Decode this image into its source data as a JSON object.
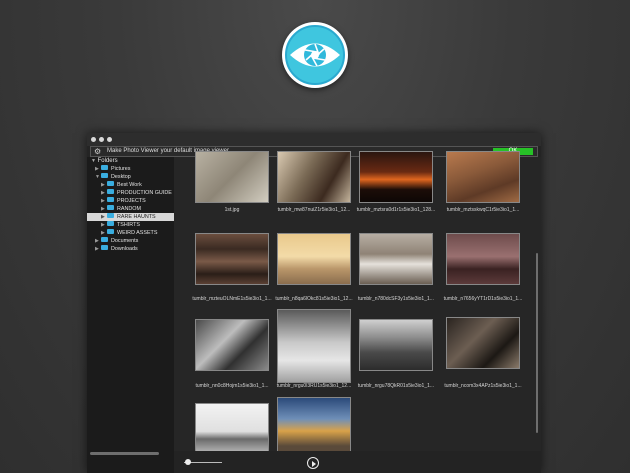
{
  "notification": {
    "message": "Make Photo Viewer your default image viewer.",
    "ok_label": "OK"
  },
  "sidebar": {
    "header": "Folders",
    "items": [
      {
        "label": "Pictures"
      },
      {
        "label": "Desktop"
      },
      {
        "label": "Best Work"
      },
      {
        "label": "PRODUCTION GUIDE"
      },
      {
        "label": "PROJECTS"
      },
      {
        "label": "RANDOM"
      },
      {
        "label": "RARE HAUNTS",
        "selected": true
      },
      {
        "label": "TSHIRTS"
      },
      {
        "label": "WEIRD ASSETS"
      },
      {
        "label": "Documents"
      },
      {
        "label": "Downloads"
      }
    ]
  },
  "thumbnails": [
    {
      "caption": "1st.jpg"
    },
    {
      "caption": "tumblr_mw87nuiZ1r5ie3io1_12..."
    },
    {
      "caption": "tumblr_mztsra0d1r1s5ie3io1_128..."
    },
    {
      "caption": "tumblr_mztsskwqC1r5ie3io1_1..."
    },
    {
      "caption": "tumblr_mzteuOLNmE1s5ie3io1_1..."
    },
    {
      "caption": "tumblr_n8qa6lOkc81s5ie3io1_12..."
    },
    {
      "caption": "tumblr_n780dcSF3y1s5ie3io1_1..."
    },
    {
      "caption": "tumblr_n7656yYT1rD1s5ie3io1_1..."
    },
    {
      "caption": "tumblr_nn0c8Hojm1s5ie3io1_1..."
    },
    {
      "caption": "tumblr_nrgu0l3RU1s5ie3io1_12..."
    },
    {
      "caption": "tumblr_nrgu78QkR01s5ie3io1_1..."
    },
    {
      "caption": "tumblr_ncom3x4APz1s5ie3io1_1..."
    },
    {
      "caption": ""
    },
    {
      "caption": ""
    }
  ],
  "zoom_slider": {
    "value": 0.1
  },
  "colors": {
    "accent": "#27c227",
    "folder": "#3aaee0",
    "logo_cyan": "#36c4de"
  },
  "icons": {
    "logo": "aperture-eye-icon",
    "play": "play-icon",
    "settings": "gear-icon",
    "folder": "folder-icon"
  }
}
